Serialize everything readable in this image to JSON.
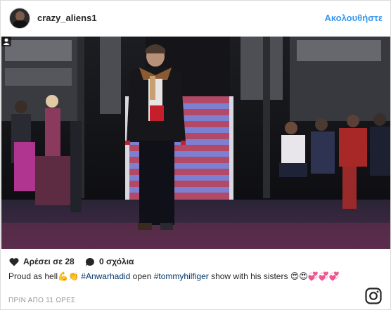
{
  "header": {
    "username": "crazy_aliens1",
    "follow_label": "Ακολουθήστε"
  },
  "post": {
    "likes_label": "Αρέσει σε 28",
    "comments_label": "0 σχόλια",
    "caption_pre": "Proud as hell",
    "caption_emoji_1": "💪👏",
    "hashtag_1": "#Anwarhadid",
    "caption_mid_1": " open ",
    "hashtag_2": "#tommyhilfiger",
    "caption_mid_2": " show with his sisters ",
    "caption_emoji_2": "😍😍💞💞💞",
    "time": "ΠΡΙΝ ΑΠΟ 11 ΩΡΕΣ"
  },
  "icons": {
    "like": "heart-icon",
    "comment": "comment-bubble-icon",
    "user_tag": "user-tag-icon",
    "logo": "instagram-logo-icon"
  },
  "colors": {
    "link": "#3897f0",
    "hashtag": "#003569",
    "text": "#262626",
    "muted": "#999999"
  }
}
